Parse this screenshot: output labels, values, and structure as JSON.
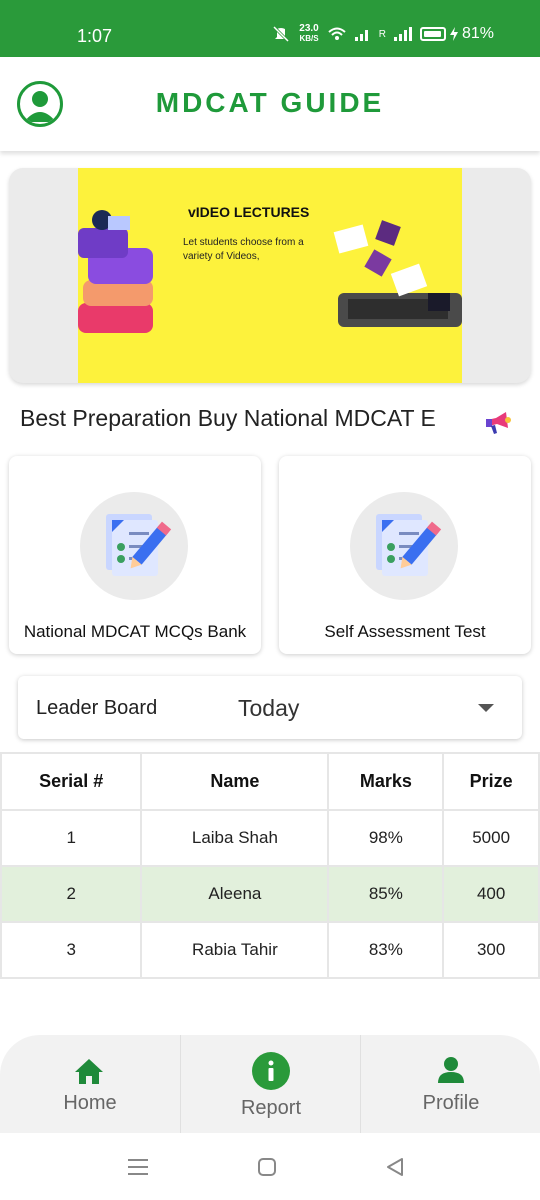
{
  "status_bar": {
    "time": "1:07",
    "net_speed_value": "23.0",
    "net_speed_unit": "KB/S",
    "roaming": "R",
    "battery": "81%"
  },
  "header": {
    "title": "MDCAT GUIDE"
  },
  "banner": {
    "title": "vIDEO LECTURES",
    "subtitle": "Let students choose from a variety of Videos,"
  },
  "marquee": {
    "text": "Best Preparation Buy National MDCAT E"
  },
  "cards": [
    {
      "label": "National MDCAT MCQs Bank",
      "icon": "checklist-pencil-icon"
    },
    {
      "label": "Self Assessment Test",
      "icon": "checklist-pencil-icon"
    }
  ],
  "leaderboard": {
    "label": "Leader Board",
    "selected": "Today",
    "columns": [
      "Serial #",
      "Name",
      "Marks",
      "Prize"
    ],
    "rows": [
      [
        "1",
        "Laiba Shah",
        "98%",
        "5000"
      ],
      [
        "2",
        "Aleena",
        "85%",
        "400"
      ],
      [
        "3",
        "Rabia Tahir",
        "83%",
        "300"
      ]
    ]
  },
  "bottom_nav": {
    "items": [
      {
        "label": "Home",
        "icon": "home-icon"
      },
      {
        "label": "Report",
        "icon": "info-icon"
      },
      {
        "label": "Profile",
        "icon": "person-icon"
      }
    ]
  },
  "colors": {
    "brand_green": "#2a9a3a",
    "highlight_row": "#e2f0dc",
    "banner_yellow": "#fdf23c"
  }
}
